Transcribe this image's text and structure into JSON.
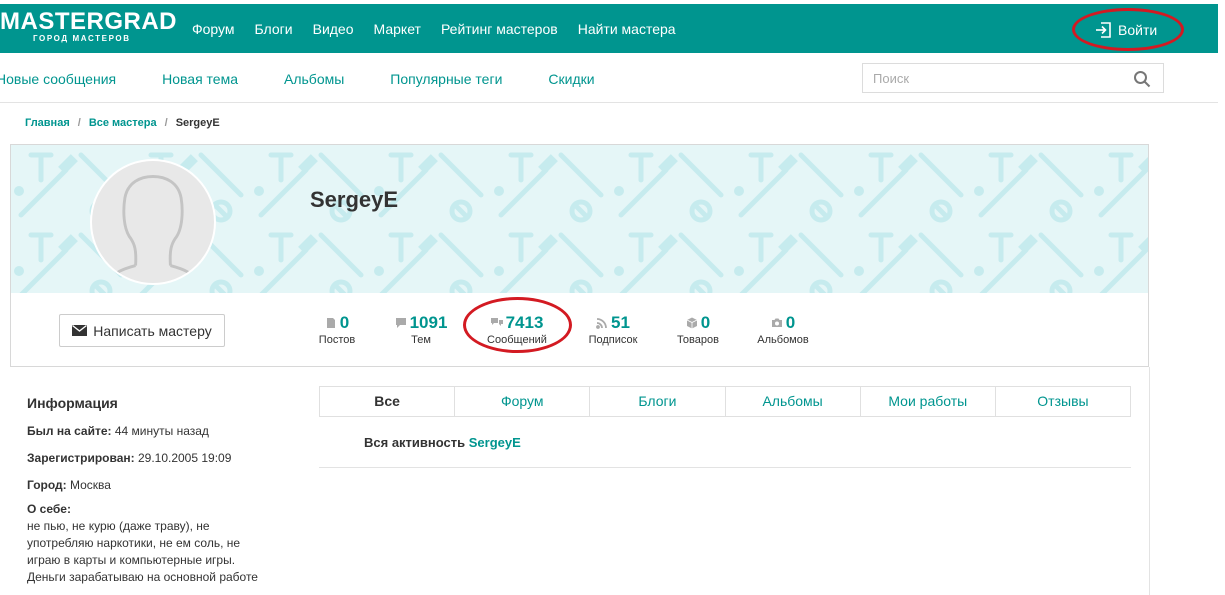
{
  "header": {
    "logo_main": "MASTERGRAD",
    "logo_sub": "ГОРОД МАСТЕРОВ",
    "nav": [
      "Форум",
      "Блоги",
      "Видео",
      "Маркет",
      "Рейтинг мастеров",
      "Найти мастера"
    ],
    "login_label": "Войти",
    "brand_color": "#00958f",
    "annotation_color": "#d31a22"
  },
  "subnav": {
    "links": [
      "Новые сообщения",
      "Новая тема",
      "Альбомы",
      "Популярные теги",
      "Скидки"
    ],
    "search_placeholder": "Поиск"
  },
  "breadcrumb": [
    "Главная",
    "Все мастера",
    "SergeyE"
  ],
  "profile": {
    "username": "SergeyE",
    "message_button": "Написать мастеру",
    "stats": [
      {
        "value": "0",
        "label": "Постов",
        "icon": "document-icon"
      },
      {
        "value": "1091",
        "label": "Тем",
        "icon": "speech-bubble-icon"
      },
      {
        "value": "7413",
        "label": "Сообщений",
        "icon": "chat-bubbles-icon"
      },
      {
        "value": "51",
        "label": "Подписок",
        "icon": "rss-icon"
      },
      {
        "value": "0",
        "label": "Товаров",
        "icon": "box-icon"
      },
      {
        "value": "0",
        "label": "Альбомов",
        "icon": "camera-icon"
      }
    ]
  },
  "info": {
    "title": "Информация",
    "last_seen_label": "Был на сайте:",
    "last_seen_value": "44 минуты назад",
    "registered_label": "Зарегистрирован:",
    "registered_value": "29.10.2005 19:09",
    "city_label": "Город:",
    "city_value": "Москва",
    "about_label": "О себе:",
    "about_lines": [
      "не пью, не курю (даже траву), не",
      "употребляю наркотики, не ем соль, не",
      "играю в карты и компьютерные игры.",
      "Деньги зарабатываю на основной работе"
    ]
  },
  "tabs": [
    "Все",
    "Форум",
    "Блоги",
    "Альбомы",
    "Мои работы",
    "Отзывы"
  ],
  "activity": {
    "label": "Вся активность",
    "user": "SergeyE"
  }
}
